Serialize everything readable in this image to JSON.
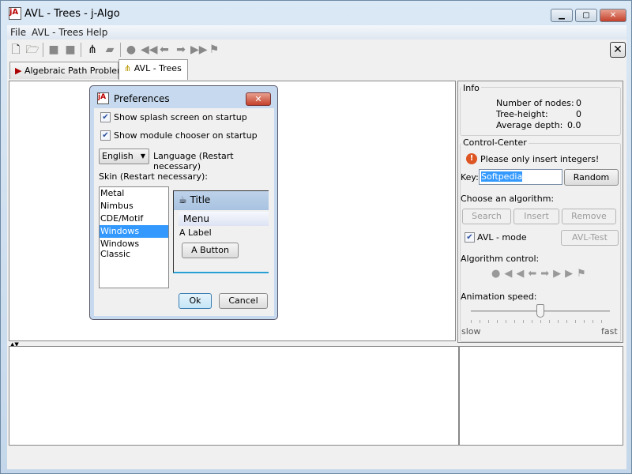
{
  "window": {
    "title": "AVL - Trees  -  j-Algo",
    "app_icon": "jA",
    "minimize": "minimize-icon",
    "maximize": "maximize-icon",
    "close": "close-icon"
  },
  "menu": [
    "File",
    "AVL - Trees",
    "Help"
  ],
  "toolbar": [
    "new-file-icon",
    "open-folder-icon",
    "save-icon",
    "save-as-icon",
    "tree-icon",
    "eraser-icon",
    "stop-icon",
    "rewind-icon",
    "step-back-icon",
    "step-forward-icon",
    "fast-forward-icon",
    "finish-flag-icon"
  ],
  "tabs": [
    {
      "label": "Algebraic Path Problem"
    },
    {
      "label": "AVL - Trees"
    }
  ],
  "close_tab": "✕",
  "dialog": {
    "title": "Preferences",
    "splash": "Show splash screen on startup",
    "splash_checked": true,
    "chooser": "Show module chooser on startup",
    "chooser_checked": true,
    "language_value": "English",
    "language_label": "Language (Restart necessary)",
    "skin_label": "Skin (Restart necessary):",
    "skins": [
      "Metal",
      "Nimbus",
      "CDE/Motif",
      "Windows",
      "Windows Classic"
    ],
    "selected_skin": "Windows",
    "preview": {
      "title": "Title",
      "menu": "Menu",
      "label": "A Label",
      "button": "A Button"
    },
    "ok": "Ok",
    "cancel": "Cancel"
  },
  "info": {
    "title": "Info",
    "rows": [
      {
        "label": "Number of nodes:",
        "value": "0"
      },
      {
        "label": "Tree-height:",
        "value": "0"
      },
      {
        "label": "Average depth:",
        "value": "0.0"
      }
    ]
  },
  "control": {
    "title": "Control-Center",
    "warning": "Please only insert integers!",
    "key_label": "Key:",
    "key_value": "Softpedia",
    "random": "Random",
    "choose": "Choose an algorithm:",
    "search": "Search",
    "insert": "Insert",
    "remove": "Remove",
    "avl_mode": "AVL - mode",
    "avl_mode_checked": true,
    "avl_test": "AVL-Test",
    "algo_control": "Algorithm control:",
    "anim_speed": "Animation speed:",
    "slow": "slow",
    "fast": "fast",
    "speed_fraction": 0.5
  }
}
